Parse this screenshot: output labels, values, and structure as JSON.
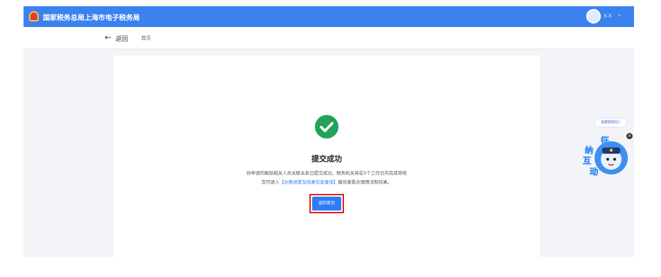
{
  "header": {
    "site_title": "国家税务总局上海市电子税务局",
    "user_name": "X.X",
    "user_caret": "⌄"
  },
  "subnav": {
    "back_arrow": "←",
    "back_label": "返回",
    "breadcrumb": "首页"
  },
  "result": {
    "title": "提交成功",
    "message_line1": "你申请的解除相关人员关联关系已提交成功，税务机关将在5个工作日内完成审核",
    "message_line2_prefix": "您可进入",
    "message_line2_link": "【办税进度及结果信息查询】",
    "message_line2_suffix": "模块查看办理情况和结果。",
    "home_button_label": "返回首页"
  },
  "assistant": {
    "help_bubble": "需要帮助吗?",
    "mascot_text": [
      "征",
      "纳",
      "互",
      "动"
    ],
    "close_label": "×"
  },
  "colors": {
    "topbar": "#3b82f0",
    "success": "#22a35a",
    "primary_button": "#2f7cf6",
    "highlight_box": "#e01d1d",
    "link": "#2d7cf0"
  },
  "icons": {
    "back": "arrow-left-icon",
    "success": "check-circle-icon",
    "logo": "tax-emblem-icon",
    "avatar": "user-avatar-icon",
    "close": "close-icon"
  }
}
